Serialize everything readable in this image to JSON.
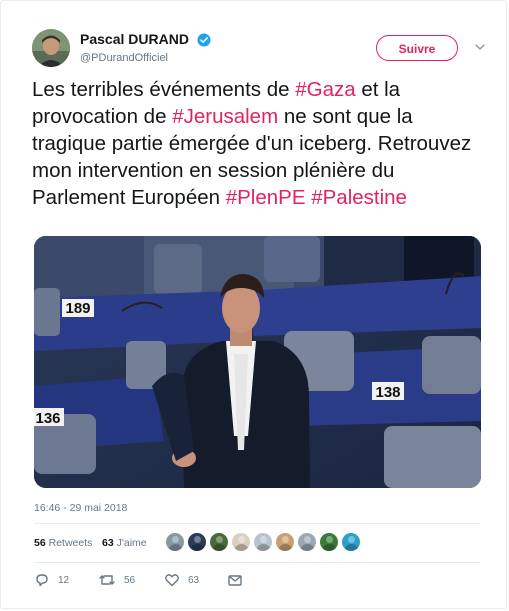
{
  "author": {
    "name": "Pascal DURAND",
    "handle": "@PDurandOfficiel",
    "verified": true
  },
  "follow_button": {
    "label": "Suivre"
  },
  "tweet": {
    "segments": [
      {
        "text": "Les terribles événements de ",
        "type": "text"
      },
      {
        "text": "#Gaza",
        "type": "hashtag"
      },
      {
        "text": " et la provocation de ",
        "type": "text"
      },
      {
        "text": "#Jerusalem",
        "type": "hashtag"
      },
      {
        "text": " ne sont que la tragique partie émergée d'un iceberg. Retrouvez mon intervention en session plénière du Parlement Européen ",
        "type": "text"
      },
      {
        "text": "#PlenPE",
        "type": "hashtag"
      },
      {
        "text": " ",
        "type": "text"
      },
      {
        "text": "#Palestine",
        "type": "hashtag"
      }
    ]
  },
  "media": {
    "seat_numbers": [
      "189",
      "138",
      "136"
    ]
  },
  "timestamp": "16:46 - 29 mai 2018",
  "stats": {
    "retweets_count": "56",
    "retweets_label": "Retweets",
    "likes_count": "63",
    "likes_label": "J'aime"
  },
  "likers": [
    "#8899a6",
    "#2b3a55",
    "#4a6a3a",
    "#d9d0c0",
    "#b8c4cc",
    "#c9a070",
    "#9aa8b4",
    "#3a7a3a",
    "#2ea0c8"
  ],
  "actions": {
    "reply_count": "12",
    "retweet_count": "56",
    "like_count": "63"
  },
  "colors": {
    "accent": "#e0245e",
    "verified": "#1da1f2",
    "muted": "#657786"
  }
}
